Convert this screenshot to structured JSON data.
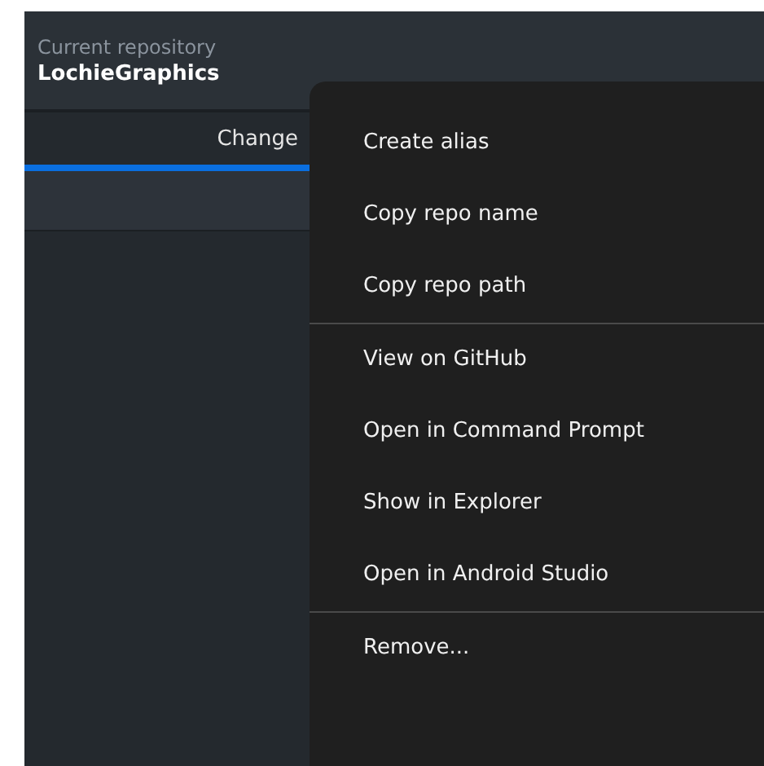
{
  "repository": {
    "label": "Current repository",
    "name": "LochieGraphics"
  },
  "tabs": [
    {
      "label": "Change",
      "selected": true
    }
  ],
  "context_menu": {
    "groups": [
      [
        {
          "label": "Create alias"
        },
        {
          "label": "Copy repo name"
        },
        {
          "label": "Copy repo path"
        }
      ],
      [
        {
          "label": "View on GitHub"
        },
        {
          "label": "Open in Command Prompt"
        },
        {
          "label": "Show in Explorer"
        },
        {
          "label": "Open in Android Studio"
        }
      ],
      [
        {
          "label": "Remove..."
        }
      ]
    ]
  }
}
